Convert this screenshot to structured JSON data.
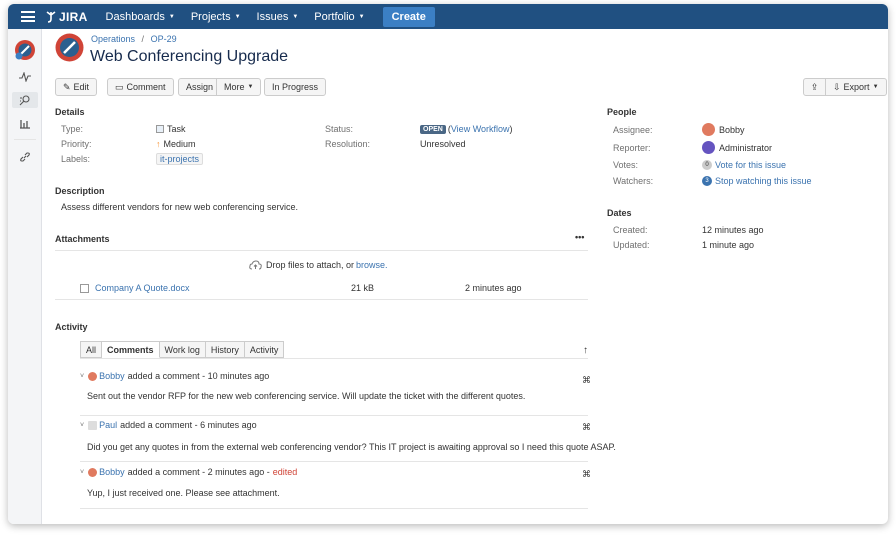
{
  "app": {
    "logo": "JIRA"
  },
  "nav": {
    "items": [
      {
        "label": "Dashboards"
      },
      {
        "label": "Projects"
      },
      {
        "label": "Issues"
      },
      {
        "label": "Portfolio"
      }
    ],
    "create": "Create"
  },
  "breadcrumb": {
    "project": "Operations",
    "sep": "/",
    "issue_key": "OP-29"
  },
  "issue": {
    "title": "Web Conferencing Upgrade"
  },
  "toolbar": {
    "edit": "Edit",
    "comment": "Comment",
    "assign": "Assign",
    "more": "More",
    "in_progress": "In Progress",
    "export": "Export"
  },
  "details": {
    "heading": "Details",
    "type_label": "Type:",
    "type": "Task",
    "priority_label": "Priority:",
    "priority": "Medium",
    "labels_label": "Labels:",
    "labels": "it-projects",
    "status_label": "Status:",
    "status": "OPEN",
    "view_workflow": "View Workflow",
    "resolution_label": "Resolution:",
    "resolution": "Unresolved"
  },
  "description": {
    "heading": "Description",
    "text": "Assess different vendors for new web conferencing service."
  },
  "attachments": {
    "heading": "Attachments",
    "more": "•••",
    "drop_text": "Drop files to attach, or ",
    "browse": "browse.",
    "files": [
      {
        "name": "Company A Quote.docx",
        "size": "21 kB",
        "date": "2 minutes ago"
      }
    ]
  },
  "activity": {
    "heading": "Activity",
    "tabs": [
      "All",
      "Comments",
      "Work log",
      "History",
      "Activity"
    ],
    "active_tab": "Comments",
    "comments": [
      {
        "author": "Bobby",
        "action": "added a comment - 10 minutes ago",
        "edited": "",
        "body": "Sent out the vendor RFP for the new web conferencing service. Will update the ticket with the different quotes."
      },
      {
        "author": "Paul",
        "action": "added a comment - 6 minutes ago",
        "edited": "",
        "body": "Did you get any quotes in from the external web conferencing vendor? This IT project is awaiting approval so I need this quote ASAP."
      },
      {
        "author": "Bobby",
        "action": "added a comment - 2 minutes ago -",
        "edited": "edited",
        "body": "Yup, I just received one. Please see attachment."
      }
    ]
  },
  "people": {
    "heading": "People",
    "assignee_label": "Assignee:",
    "assignee": "Bobby",
    "reporter_label": "Reporter:",
    "reporter": "Administrator",
    "votes_label": "Votes:",
    "votes_count": "0",
    "votes_link": "Vote for this issue",
    "watchers_label": "Watchers:",
    "watchers_count": "3",
    "watchers_link": "Stop watching this issue"
  },
  "dates": {
    "heading": "Dates",
    "created_label": "Created:",
    "created": "12 minutes ago",
    "updated_label": "Updated:",
    "updated": "1 minute ago"
  },
  "colors": {
    "header": "#205081",
    "create": "#3b7fc4",
    "link": "#3b73af",
    "lozenge": "#4a6785",
    "edited": "#d04437"
  }
}
